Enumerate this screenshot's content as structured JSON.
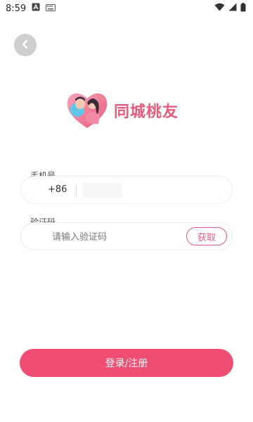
{
  "status_bar": {
    "time": "8:59",
    "left_icons": [
      "a-icon",
      "keyboard-icon"
    ],
    "right_icons": [
      "wifi-icon",
      "signal-icon",
      "battery-icon"
    ]
  },
  "header": {
    "back_icon": "chevron-left-icon"
  },
  "logo": {
    "title": "同城桃友",
    "accent": "#e85a7c"
  },
  "form": {
    "phone": {
      "label": "手机号",
      "country_code": "+86"
    },
    "code": {
      "label": "验证码",
      "placeholder": "请输入验证码",
      "get_code_label": "获取"
    }
  },
  "actions": {
    "submit_label": "登录/注册",
    "button_color": "#f04d72"
  }
}
